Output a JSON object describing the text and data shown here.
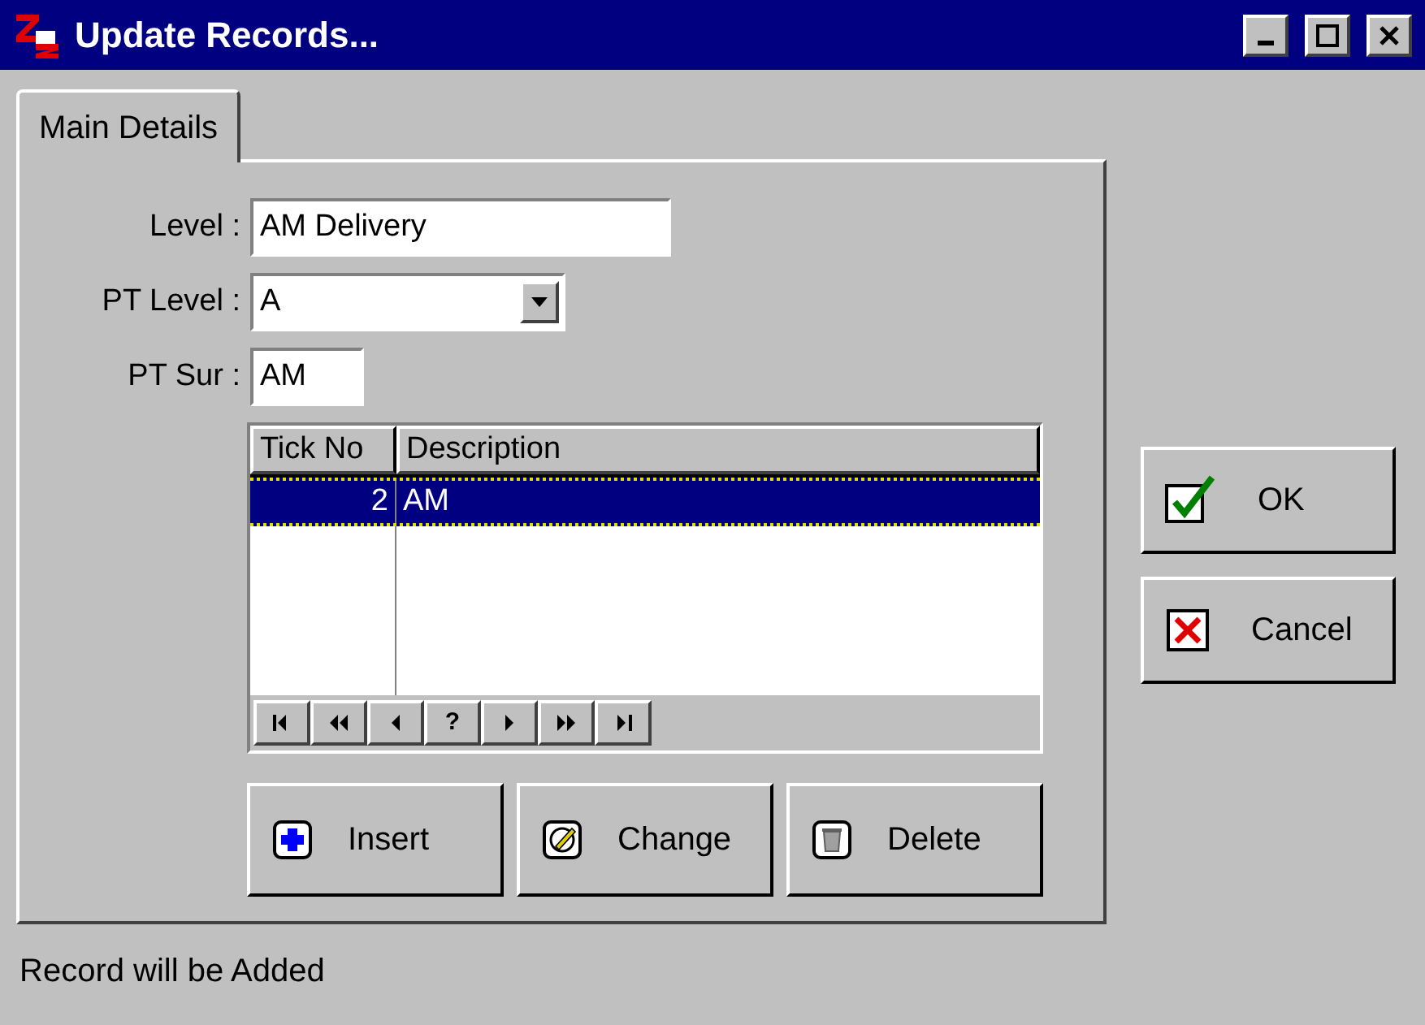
{
  "window": {
    "title": "Update Records..."
  },
  "tabs": [
    {
      "label": "Main Details",
      "selected": true
    }
  ],
  "fields": [
    {
      "kind": "text",
      "label": "Level :",
      "value": "AM Delivery"
    },
    {
      "kind": "select",
      "label": "PT Level :",
      "value": "A"
    },
    {
      "kind": "short",
      "label": "PT Sur :",
      "value": "AM"
    }
  ],
  "table": {
    "columns": [
      "Tick No",
      "Description"
    ],
    "rows": [
      {
        "cells": [
          "2",
          "AM"
        ],
        "selected": true
      }
    ]
  },
  "navigator": [
    {
      "kind": "first"
    },
    {
      "kind": "prior-page"
    },
    {
      "kind": "prior"
    },
    {
      "kind": "text",
      "label": "?"
    },
    {
      "kind": "next"
    },
    {
      "kind": "next-page"
    },
    {
      "kind": "last"
    }
  ],
  "actions": [
    {
      "kind": "insert",
      "label": "Insert"
    },
    {
      "kind": "change",
      "label": "Change"
    },
    {
      "kind": "delete",
      "label": "Delete"
    }
  ],
  "dialog_buttons": [
    {
      "kind": "ok",
      "label": "OK"
    },
    {
      "kind": "cancel",
      "label": "Cancel"
    }
  ],
  "status_bar": "Record will be Added"
}
